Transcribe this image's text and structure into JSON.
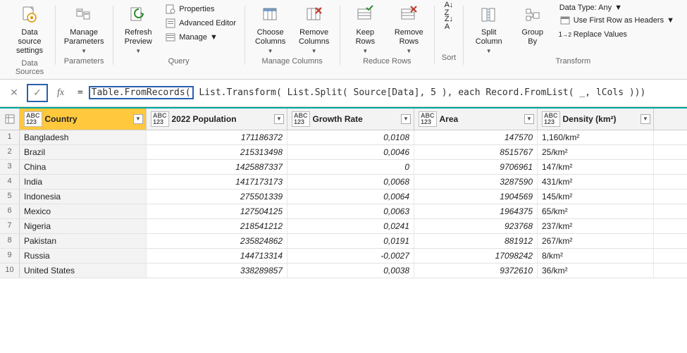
{
  "ribbon": {
    "data_source_settings": "Data source\nsettings",
    "manage_parameters": "Manage\nParameters",
    "refresh_preview": "Refresh\nPreview",
    "properties": "Properties",
    "advanced_editor": "Advanced Editor",
    "manage": "Manage",
    "choose_columns": "Choose\nColumns",
    "remove_columns": "Remove\nColumns",
    "keep_rows": "Keep\nRows",
    "remove_rows": "Remove\nRows",
    "split_column": "Split\nColumn",
    "group_by": "Group\nBy",
    "data_type": "Data Type: Any",
    "use_first_row": "Use First Row as Headers",
    "replace_values": "Replace Values",
    "group_labels": {
      "data_sources": "Data Sources",
      "parameters": "Parameters",
      "query": "Query",
      "manage_columns": "Manage Columns",
      "reduce_rows": "Reduce Rows",
      "sort": "Sort",
      "transform": "Transform"
    }
  },
  "formula": {
    "prefix": "= ",
    "highlight": "Table.FromRecords(",
    "rest": " List.Transform( List.Split( Source[Data], 5 ), each Record.FromList( _, lCols )))"
  },
  "columns": {
    "country": "Country",
    "population": "2022 Population",
    "growth": "Growth Rate",
    "area": "Area",
    "density": "Density (km²)"
  },
  "type_label_top": "ABC",
  "type_label_bot": "123",
  "rows": [
    {
      "n": "1",
      "country": "Bangladesh",
      "pop": "171186372",
      "growth": "0,0108",
      "area": "147570",
      "density": "1,160/km²"
    },
    {
      "n": "2",
      "country": "Brazil",
      "pop": "215313498",
      "growth": "0,0046",
      "area": "8515767",
      "density": "25/km²"
    },
    {
      "n": "3",
      "country": "China",
      "pop": "1425887337",
      "growth": "0",
      "area": "9706961",
      "density": "147/km²"
    },
    {
      "n": "4",
      "country": "India",
      "pop": "1417173173",
      "growth": "0,0068",
      "area": "3287590",
      "density": "431/km²"
    },
    {
      "n": "5",
      "country": "Indonesia",
      "pop": "275501339",
      "growth": "0,0064",
      "area": "1904569",
      "density": "145/km²"
    },
    {
      "n": "6",
      "country": "Mexico",
      "pop": "127504125",
      "growth": "0,0063",
      "area": "1964375",
      "density": "65/km²"
    },
    {
      "n": "7",
      "country": "Nigeria",
      "pop": "218541212",
      "growth": "0,0241",
      "area": "923768",
      "density": "237/km²"
    },
    {
      "n": "8",
      "country": "Pakistan",
      "pop": "235824862",
      "growth": "0,0191",
      "area": "881912",
      "density": "267/km²"
    },
    {
      "n": "9",
      "country": "Russia",
      "pop": "144713314",
      "growth": "-0,0027",
      "area": "17098242",
      "density": "8/km²"
    },
    {
      "n": "10",
      "country": "United States",
      "pop": "338289857",
      "growth": "0,0038",
      "area": "9372610",
      "density": "36/km²"
    }
  ]
}
